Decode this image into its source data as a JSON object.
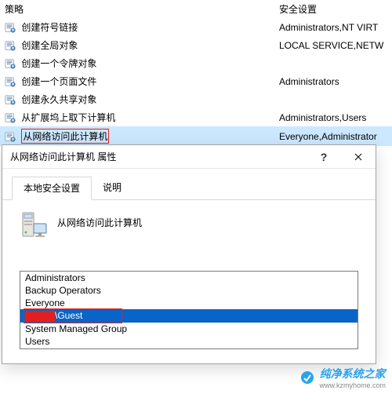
{
  "list": {
    "header_policy": "策略",
    "header_setting": "安全设置",
    "rows": [
      {
        "label": "创建符号链接",
        "setting": "Administrators,NT VIRT"
      },
      {
        "label": "创建全局对象",
        "setting": "LOCAL SERVICE,NETW"
      },
      {
        "label": "创建一个令牌对象",
        "setting": ""
      },
      {
        "label": "创建一个页面文件",
        "setting": "Administrators"
      },
      {
        "label": "创建永久共享对象",
        "setting": ""
      },
      {
        "label": "从扩展坞上取下计算机",
        "setting": "Administrators,Users"
      },
      {
        "label": "从网络访问此计算机",
        "setting": "Everyone,Administrator"
      }
    ]
  },
  "dialog": {
    "title": "从网络访问此计算机 属性",
    "help_symbol": "?",
    "tabs": {
      "t0": "本地安全设置",
      "t1": "说明"
    },
    "policy_name": "从网络访问此计算机",
    "principals": [
      "Administrators",
      "Backup Operators",
      "Everyone",
      "____\\Guest",
      "System Managed Group",
      "Users"
    ],
    "guest_visible": "\\Guest"
  },
  "watermark": {
    "cn": "纯净系统之家",
    "url": "www.kzmyhome.com"
  }
}
